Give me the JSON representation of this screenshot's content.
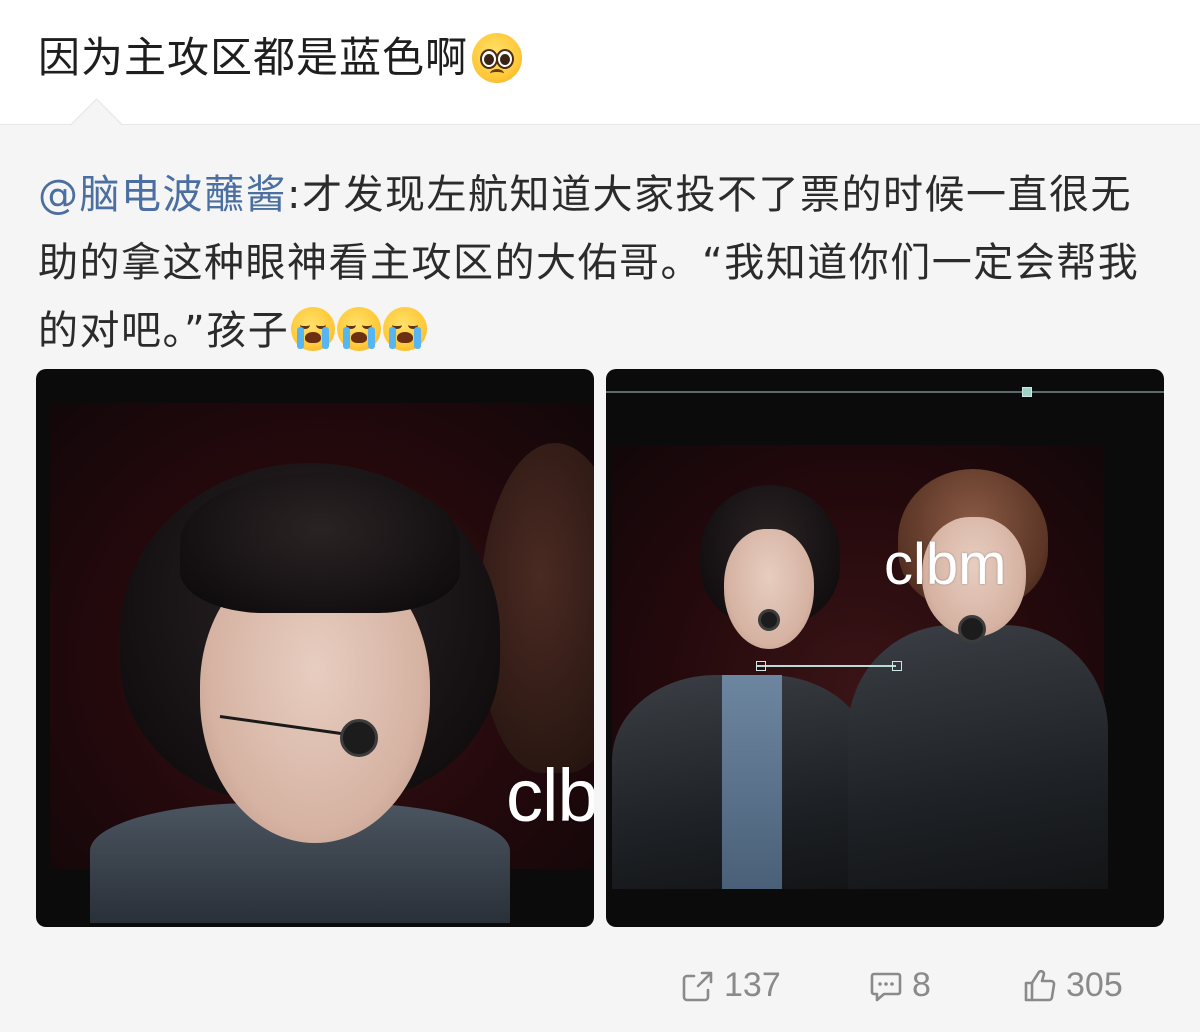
{
  "post": {
    "text": "因为主攻区都是蓝色啊",
    "emoji": "pleading-face"
  },
  "repost": {
    "author": "@脑电波蘸酱",
    "text": ":才发现左航知道大家投不了票的时候一直很无助的拿这种眼神看主攻区的大佑哥。“我知道你们一定会帮我的对吧。”孩子",
    "emojis": [
      "loudly-crying-face",
      "loudly-crying-face",
      "loudly-crying-face"
    ],
    "images": [
      {
        "alt": "close-up photo of performer wearing headset mic",
        "watermark": "clb"
      },
      {
        "alt": "photo of two performers on stage holding microphones",
        "watermark": "clbm"
      }
    ]
  },
  "actions": {
    "share_count": "137",
    "comment_count": "8",
    "like_count": "305"
  },
  "colors": {
    "mention": "#4b6fa1",
    "text": "#1e1e1e",
    "repost_bg": "#f5f5f5",
    "action": "#8a8a8a"
  }
}
